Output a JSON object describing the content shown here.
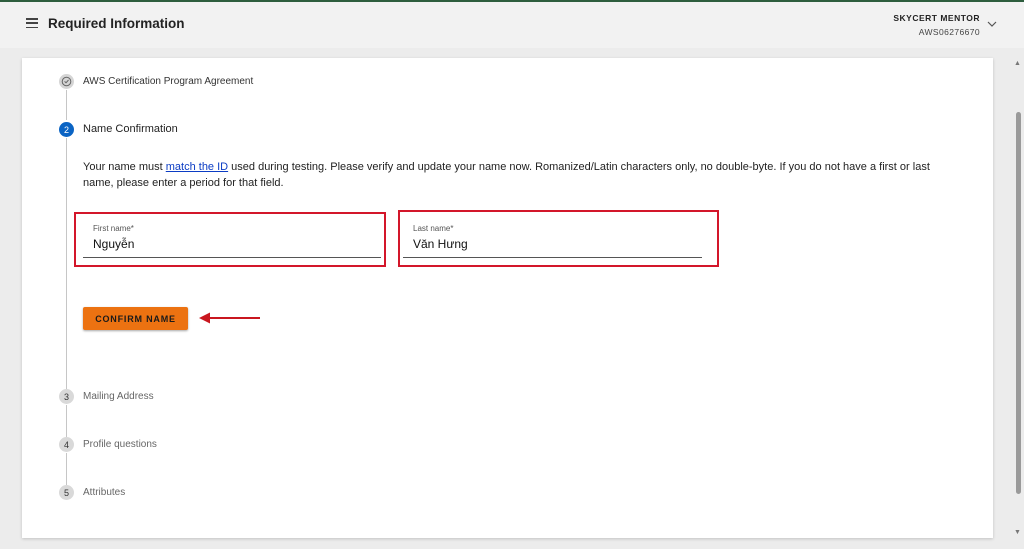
{
  "header": {
    "title": "Required Information",
    "user_name": "SKYCERT MENTOR",
    "user_id": "AWS06276670"
  },
  "steps": [
    {
      "number": "",
      "label": "AWS Certification Program Agreement",
      "state": "completed"
    },
    {
      "number": "2",
      "label": "Name Confirmation",
      "state": "active"
    },
    {
      "number": "3",
      "label": "Mailing Address",
      "state": "pending"
    },
    {
      "number": "4",
      "label": "Profile questions",
      "state": "pending"
    },
    {
      "number": "5",
      "label": "Attributes",
      "state": "pending"
    }
  ],
  "name_confirmation": {
    "instructions_before_link": "Your name must ",
    "link_text": "match the ID",
    "instructions_after_link": " used during testing. Please verify and update your name now. Romanized/Latin characters only, no double-byte. If you do not have a first or last name, please enter a period for that field.",
    "first_name_label": "First name*",
    "first_name_value": "Nguyễn",
    "last_name_label": "Last name*",
    "last_name_value": "Văn Hưng",
    "confirm_button": "CONFIRM NAME"
  },
  "colors": {
    "accent": "#ec7211",
    "active_step": "#0b64c4",
    "highlight": "#d3162a",
    "link": "#0b3cc4"
  },
  "icons": {
    "menu": "hamburger-menu-icon",
    "user_menu": "chevron-down-icon",
    "step_done": "check-circle-icon",
    "annotation": "red-arrow-icon"
  }
}
